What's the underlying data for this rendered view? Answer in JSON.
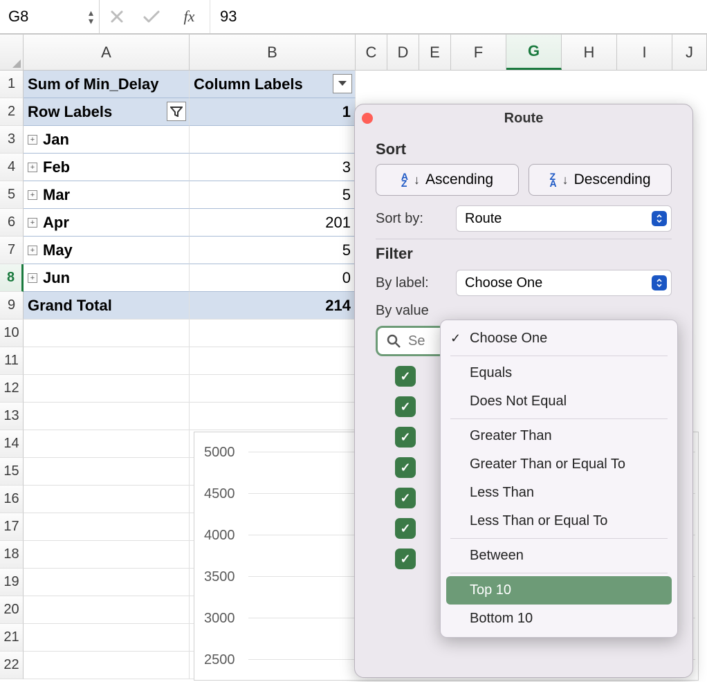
{
  "formula_bar": {
    "name_box": "G8",
    "fx_label": "fx",
    "value": "93"
  },
  "columns": [
    "A",
    "B",
    "C",
    "D",
    "E",
    "F",
    "G",
    "H",
    "I",
    "J"
  ],
  "active_column": "G",
  "row_numbers": [
    "1",
    "2",
    "3",
    "4",
    "5",
    "6",
    "7",
    "8",
    "9",
    "10",
    "11",
    "12",
    "13",
    "14",
    "15",
    "16",
    "17",
    "18",
    "19",
    "20",
    "21",
    "22"
  ],
  "active_row": "8",
  "pivot": {
    "sum_label": "Sum of Min_Delay",
    "col_labels": "Column Labels",
    "row_labels": "Row Labels",
    "col_value_1": "1",
    "rows": [
      {
        "month": "Jan",
        "val": ""
      },
      {
        "month": "Feb",
        "val": "3"
      },
      {
        "month": "Mar",
        "val": "5"
      },
      {
        "month": "Apr",
        "val": "201"
      },
      {
        "month": "May",
        "val": "5"
      },
      {
        "month": "Jun",
        "val": "0"
      }
    ],
    "grand_total_label": "Grand Total",
    "grand_total_value": "214"
  },
  "chart_data": {
    "type": "bar",
    "y_ticks": [
      "5000",
      "4500",
      "4000",
      "3500",
      "3000",
      "2500"
    ],
    "ylim": [
      2500,
      5000
    ]
  },
  "popover": {
    "title": "Route",
    "sort_label": "Sort",
    "asc_label": "Ascending",
    "desc_label": "Descending",
    "sort_by_label": "Sort by:",
    "sort_by_value": "Route",
    "filter_label": "Filter",
    "by_label_label": "By label:",
    "by_label_value": "Choose One",
    "by_value_label": "By value",
    "search_placeholder": "Se",
    "checked_count": 7
  },
  "dropdown": {
    "choose_one": "Choose One",
    "equals": "Equals",
    "does_not_equal": "Does Not Equal",
    "greater_than": "Greater Than",
    "gte": "Greater Than or Equal To",
    "less_than": "Less Than",
    "lte": "Less Than or Equal To",
    "between": "Between",
    "top10": "Top 10",
    "bottom10": "Bottom 10"
  }
}
